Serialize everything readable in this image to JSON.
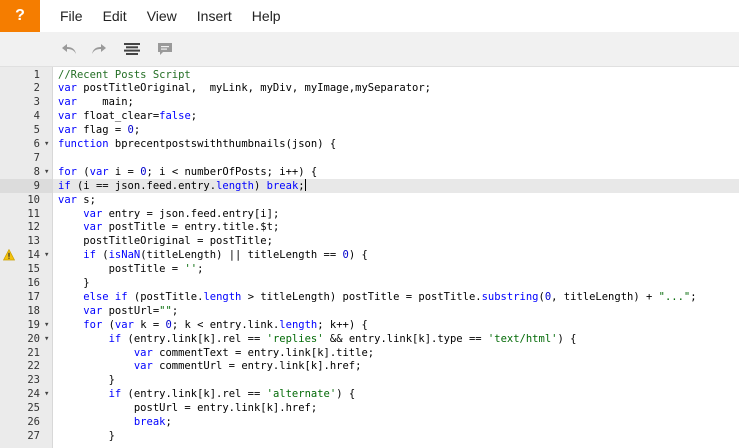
{
  "app": {
    "logo_text": "?"
  },
  "menu": [
    "File",
    "Edit",
    "View",
    "Insert",
    "Help"
  ],
  "toolbar": {
    "buttons": [
      {
        "name": "undo-icon"
      },
      {
        "name": "redo-icon"
      },
      {
        "name": "format-icon"
      },
      {
        "name": "comment-icon"
      }
    ]
  },
  "editor": {
    "active_line": 9,
    "warning_line": 14,
    "lines": [
      {
        "n": "1",
        "code": "//Recent Posts Script",
        "fold": ""
      },
      {
        "n": "2",
        "code": "var postTitleOriginal,  myLink, myDiv, myImage,mySeparator;",
        "fold": ""
      },
      {
        "n": "3",
        "code": "var    main;",
        "fold": ""
      },
      {
        "n": "4",
        "code": "var float_clear=false;",
        "fold": ""
      },
      {
        "n": "5",
        "code": "var flag = 0;",
        "fold": ""
      },
      {
        "n": "6",
        "code": "function bprecentpostswiththumbnails(json) {",
        "fold": "▾"
      },
      {
        "n": "7",
        "code": "",
        "fold": ""
      },
      {
        "n": "8",
        "code": "for (var i = 0; i < numberOfPosts; i++) {",
        "fold": "▾"
      },
      {
        "n": "9",
        "code": "if (i == json.feed.entry.length) break;",
        "fold": ""
      },
      {
        "n": "10",
        "code": "var s;",
        "fold": ""
      },
      {
        "n": "11",
        "code": "    var entry = json.feed.entry[i];",
        "fold": ""
      },
      {
        "n": "12",
        "code": "    var postTitle = entry.title.$t;",
        "fold": ""
      },
      {
        "n": "13",
        "code": "    postTitleOriginal = postTitle;",
        "fold": ""
      },
      {
        "n": "14",
        "code": "    if (isNaN(titleLength) || titleLength == 0) {",
        "fold": "▾"
      },
      {
        "n": "15",
        "code": "        postTitle = '';",
        "fold": ""
      },
      {
        "n": "16",
        "code": "    }",
        "fold": ""
      },
      {
        "n": "17",
        "code": "    else if (postTitle.length > titleLength) postTitle = postTitle.substring(0, titleLength) + \"...\";",
        "fold": ""
      },
      {
        "n": "18",
        "code": "    var postUrl=\"\";",
        "fold": ""
      },
      {
        "n": "19",
        "code": "    for (var k = 0; k < entry.link.length; k++) {",
        "fold": "▾"
      },
      {
        "n": "20",
        "code": "        if (entry.link[k].rel == 'replies' && entry.link[k].type == 'text/html') {",
        "fold": "▾"
      },
      {
        "n": "21",
        "code": "            var commentText = entry.link[k].title;",
        "fold": ""
      },
      {
        "n": "22",
        "code": "            var commentUrl = entry.link[k].href;",
        "fold": ""
      },
      {
        "n": "23",
        "code": "        }",
        "fold": ""
      },
      {
        "n": "24",
        "code": "        if (entry.link[k].rel == 'alternate') {",
        "fold": "▾"
      },
      {
        "n": "25",
        "code": "            postUrl = entry.link[k].href;",
        "fold": ""
      },
      {
        "n": "26",
        "code": "            break;",
        "fold": ""
      },
      {
        "n": "27",
        "code": "        }",
        "fold": ""
      }
    ]
  }
}
